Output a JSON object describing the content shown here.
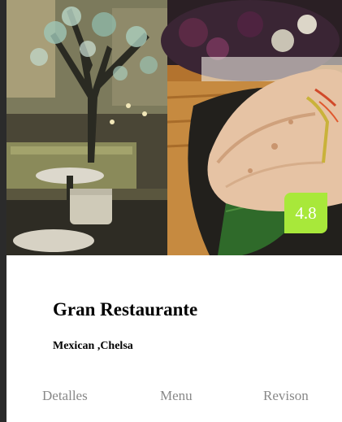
{
  "restaurant": {
    "name": "Gran Restaurante",
    "tags": "Mexican ,Chelsa",
    "rating": "4.8"
  },
  "tabs": [
    {
      "label": "Detalles"
    },
    {
      "label": "Menu"
    },
    {
      "label": "Revison"
    }
  ],
  "colors": {
    "rating_badge": "#a8e83a",
    "tab_text": "#888888",
    "page_background": "#2b2b2b"
  }
}
